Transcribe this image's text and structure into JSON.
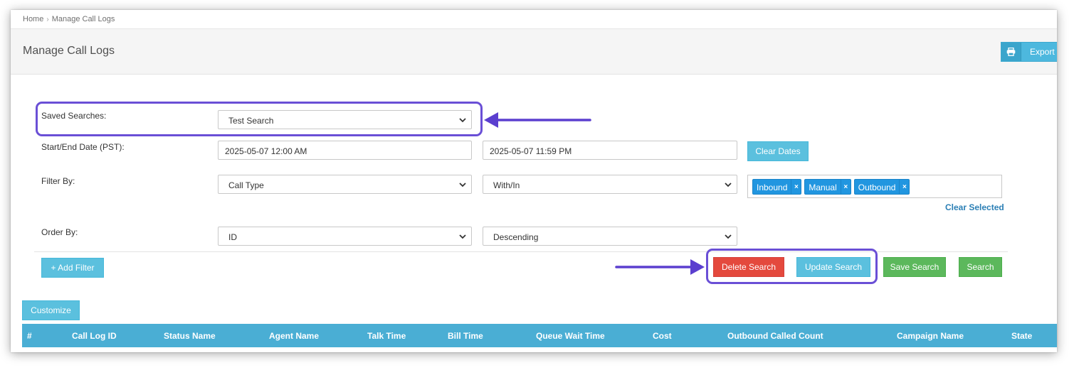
{
  "breadcrumb": {
    "home": "Home",
    "separator": "›",
    "current": "Manage Call Logs"
  },
  "header": {
    "title": "Manage Call Logs",
    "export_label": "Export",
    "export_icon": "printer-icon"
  },
  "form": {
    "saved_searches": {
      "label": "Saved Searches:",
      "value": "Test Search"
    },
    "dates": {
      "label": "Start/End Date (PST):",
      "start": "2025-05-07 12:00 AM",
      "end": "2025-05-07 11:59 PM",
      "clear_label": "Clear Dates"
    },
    "filter": {
      "label": "Filter By:",
      "field": "Call Type",
      "operator": "With/In",
      "tags": [
        "Inbound",
        "Manual",
        "Outbound"
      ],
      "tag_remove": "×",
      "clear_selected": "Clear Selected"
    },
    "order": {
      "label": "Order By:",
      "field": "ID",
      "direction": "Descending"
    }
  },
  "actions": {
    "add_filter": "+ Add Filter",
    "delete_search": "Delete Search",
    "update_search": "Update Search",
    "save_search": "Save Search",
    "search": "Search"
  },
  "customize_label": "Customize",
  "table": {
    "columns": [
      "#",
      "Call Log ID",
      "Status Name",
      "Agent Name",
      "Talk Time",
      "Bill Time",
      "Queue Wait Time",
      "Cost",
      "Outbound Called Count",
      "Campaign Name",
      "State"
    ]
  },
  "colors": {
    "info": "#5bc0de",
    "danger": "#e4493d",
    "success": "#5cb85c",
    "tag": "#2196e0",
    "annotation": "#6a4fd6",
    "table_header": "#4aaed4"
  }
}
